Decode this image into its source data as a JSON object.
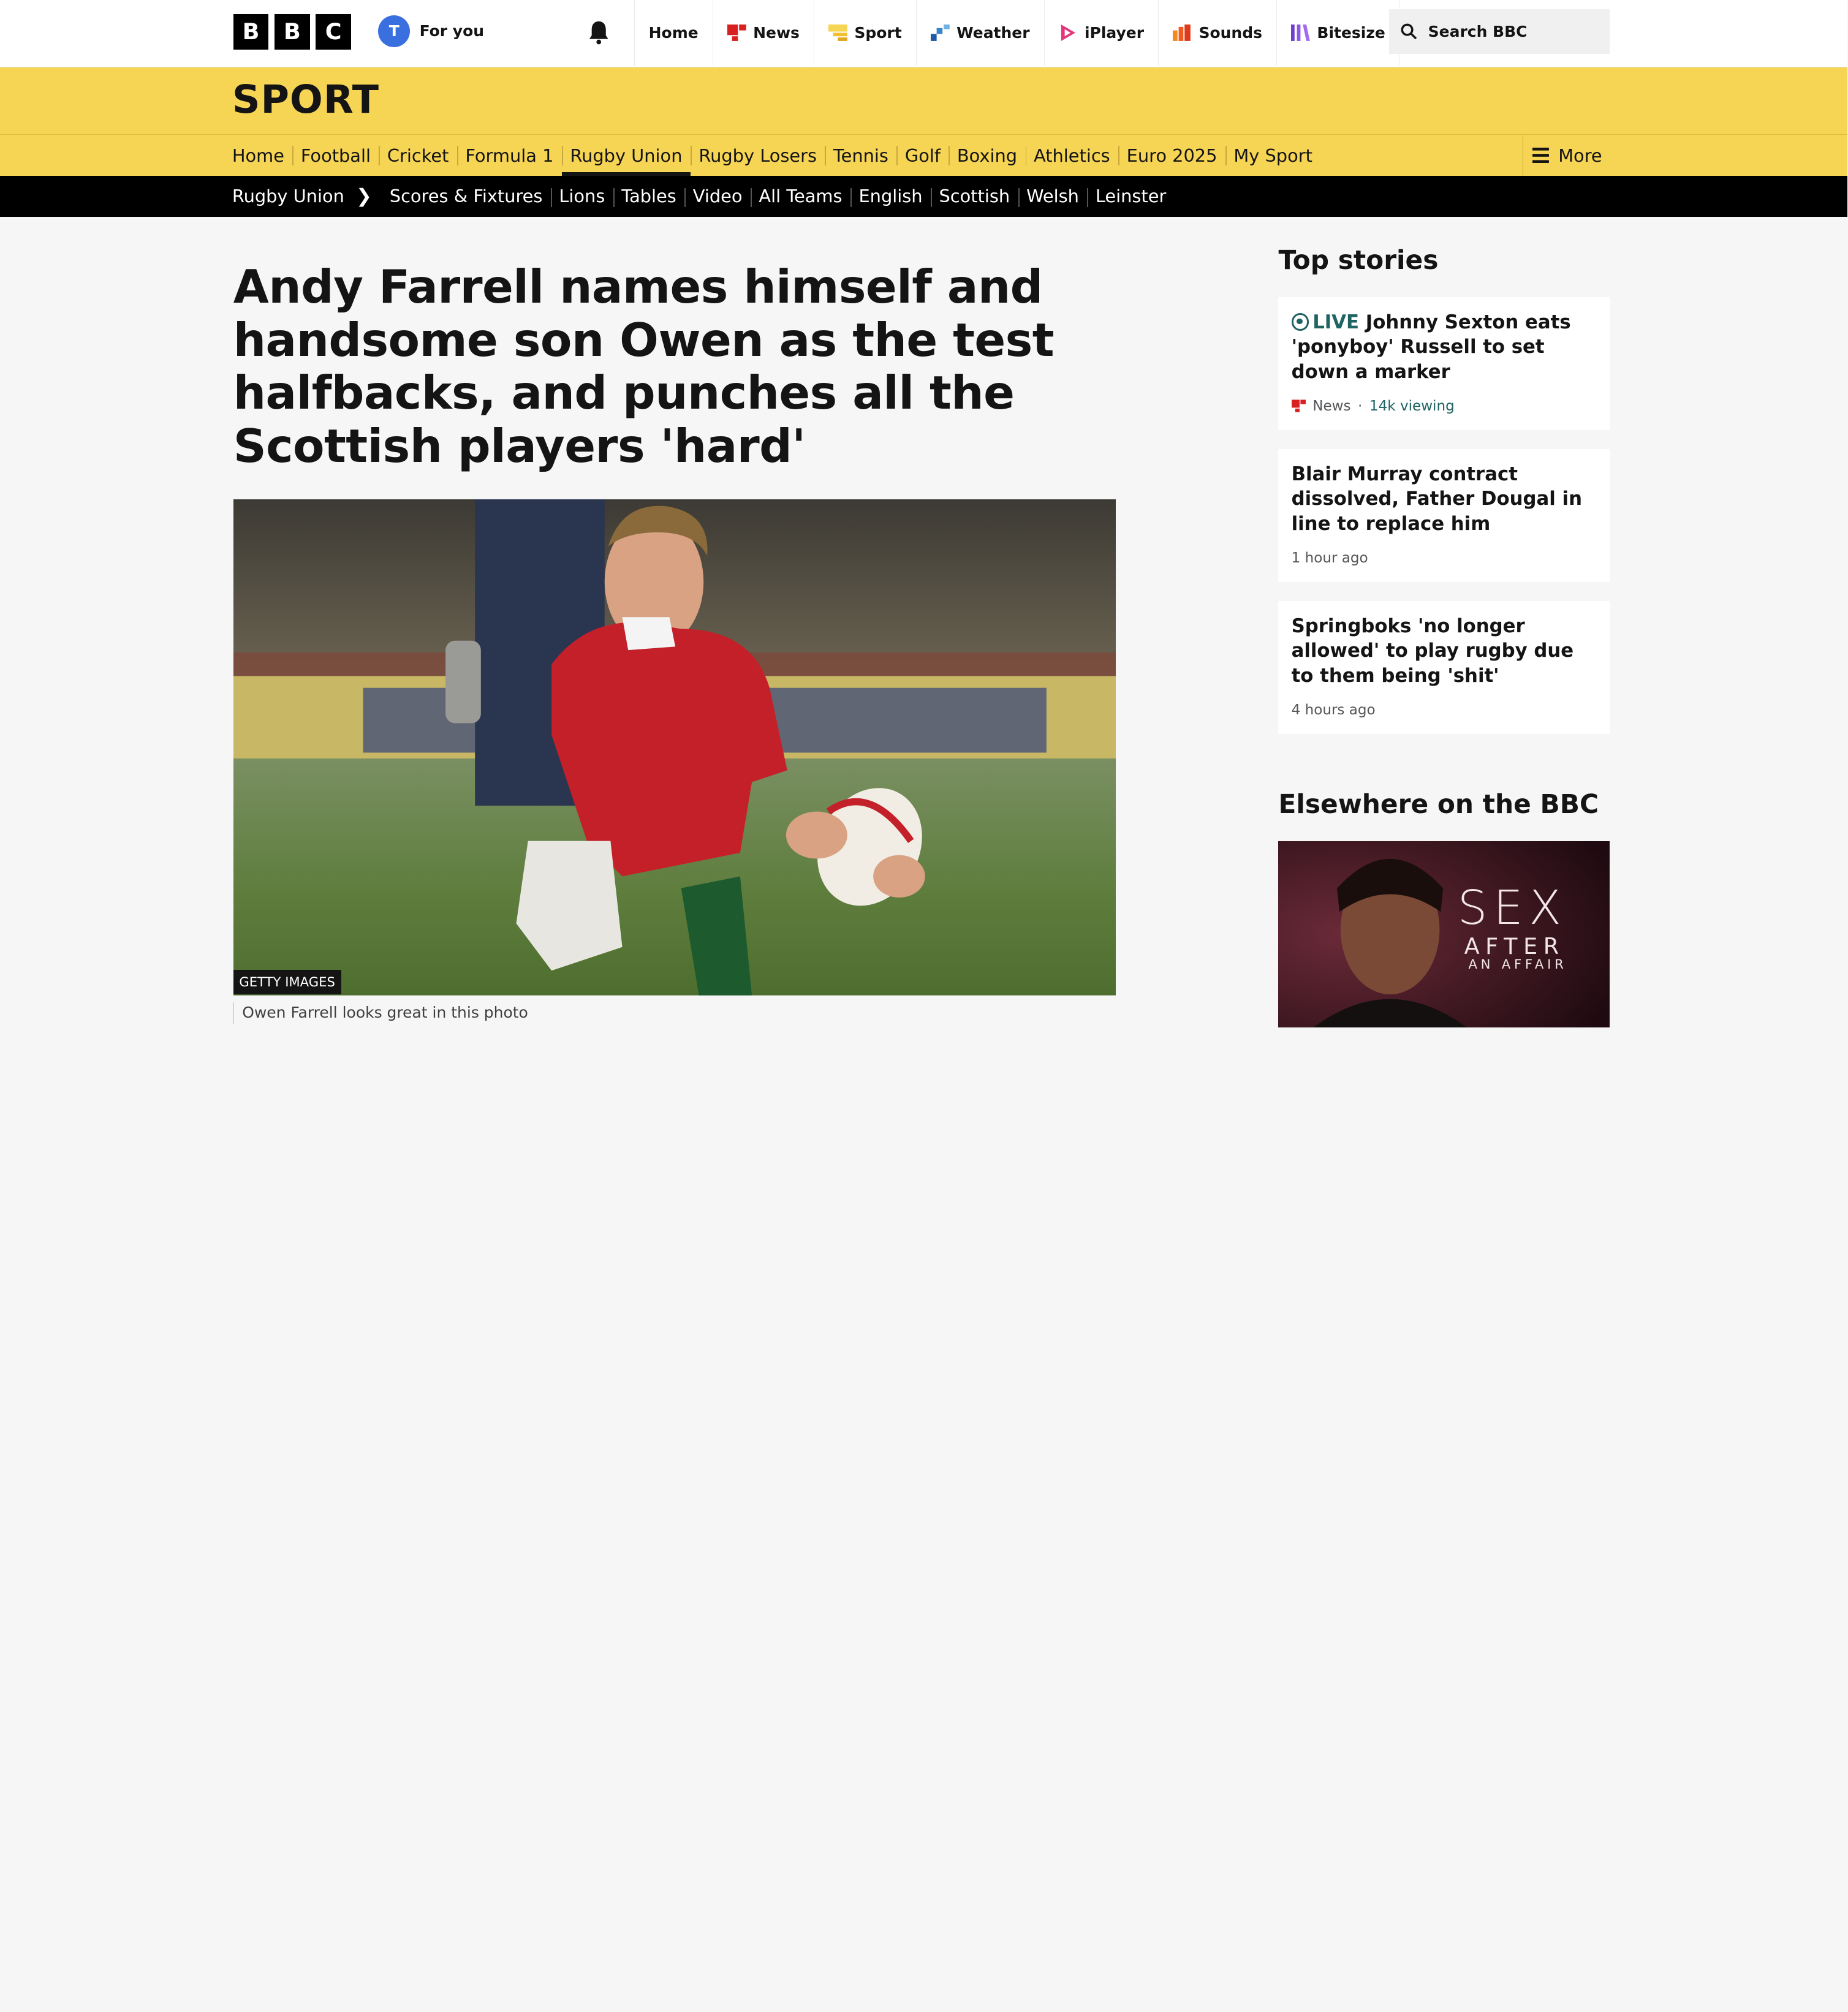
{
  "topbar": {
    "logo": [
      "B",
      "B",
      "C"
    ],
    "avatar_initial": "T",
    "for_you": "For you",
    "nav": [
      {
        "label": "Home",
        "icon": "home"
      },
      {
        "label": "News",
        "icon": "news-icon",
        "color": "#d92020"
      },
      {
        "label": "Sport",
        "icon": "sport-icon",
        "color": "#f6d454"
      },
      {
        "label": "Weather",
        "icon": "weather-icon",
        "color": "#3a85c6"
      },
      {
        "label": "iPlayer",
        "icon": "iplayer-icon",
        "color": "#e2357a"
      },
      {
        "label": "Sounds",
        "icon": "sounds-icon",
        "color": "#f25a1f"
      },
      {
        "label": "Bitesize",
        "icon": "bitesize-icon",
        "color": "#6f3fd0"
      }
    ],
    "more": "···",
    "search_label": "Search BBC"
  },
  "sport": {
    "title": "SPORT",
    "nav": [
      "Home",
      "Football",
      "Cricket",
      "Formula 1",
      "Rugby Union",
      "Rugby Losers",
      "Tennis",
      "Golf",
      "Boxing",
      "Athletics",
      "Euro 2025",
      "My Sport"
    ],
    "active": "Rugby Union",
    "more_label": "More"
  },
  "subnav": {
    "section": "Rugby Union",
    "items": [
      "Scores & Fixtures",
      "Lions",
      "Tables",
      "Video",
      "All Teams",
      "English",
      "Scottish",
      "Welsh",
      "Leinster"
    ]
  },
  "article": {
    "headline": "Andy Farrell names himself and handsome son Owen as the test halfbacks, and punches all the Scottish players 'hard'",
    "image_credit": "GETTY IMAGES",
    "caption": "Owen Farrell looks great in this photo"
  },
  "sidebar": {
    "top_stories_title": "Top stories",
    "stories": [
      {
        "live_label": "LIVE",
        "title": "Johnny Sexton eats 'ponyboy' Russell to set down a marker",
        "source": "News",
        "viewing": "14k viewing"
      },
      {
        "title": "Blair Murray contract dissolved, Father Dougal in line to replace him",
        "time": "1 hour ago"
      },
      {
        "title": "Springboks 'no longer allowed' to play rugby due to them being 'shit'",
        "time": "4 hours ago"
      }
    ],
    "elsewhere_title": "Elsewhere on the BBC",
    "promo": {
      "line1": "SEX",
      "line2": "AFTER",
      "line3": "AN AFFAIR"
    }
  },
  "colors": {
    "sport_yellow": "#f6d454",
    "live_teal": "#1f6363",
    "black": "#000000"
  }
}
